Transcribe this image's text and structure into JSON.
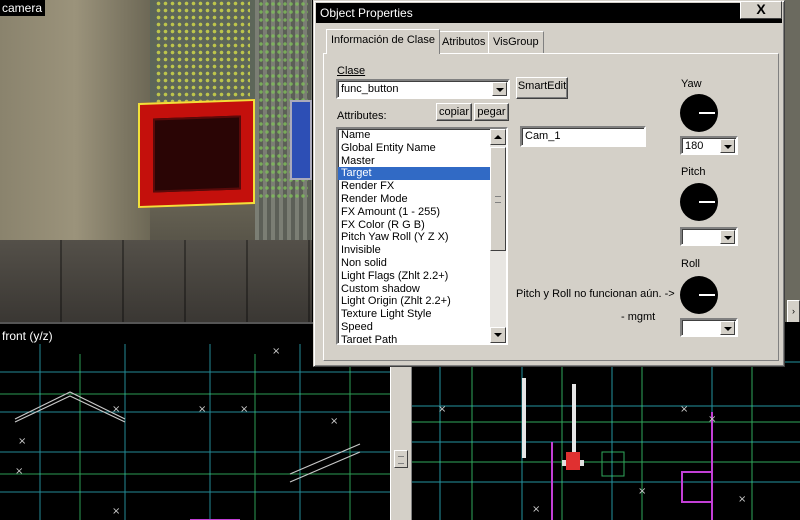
{
  "camera": {
    "label": "camera"
  },
  "front_view": {
    "label": "front (y/z)"
  },
  "dialog": {
    "title": "Object Properties",
    "close_label": "X",
    "tabs": [
      {
        "label": "Información de Clase",
        "active": true
      },
      {
        "label": "Atributos",
        "active": false
      },
      {
        "label": "VisGroup",
        "active": false
      }
    ],
    "class_label": "Clase",
    "class_value": "func_button",
    "smartedit_label": "SmartEdit",
    "attributes_label": "Attributes:",
    "copy_label": "copiar",
    "paste_label": "pegar",
    "attributes": [
      "Name",
      "Global Entity Name",
      "Master",
      "Target",
      "Render FX",
      "Render Mode",
      "FX Amount (1 - 255)",
      "FX Color (R G B)",
      "Pitch Yaw Roll (Y Z X)",
      "Invisible",
      "Non solid",
      "Light Flags (Zhlt 2.2+)",
      "Custom shadow",
      "Light Origin (Zhlt 2.2+)",
      "Texture Light Style",
      "Speed",
      "Target Path"
    ],
    "selected_attribute": "Target",
    "value_field": "Cam_1",
    "note_text": "Pitch y Roll no funcionan aún. ->",
    "note_author": "- mgmt",
    "yaw_label": "Yaw",
    "yaw_value": "180",
    "pitch_label": "Pitch",
    "pitch_value": "",
    "roll_label": "Roll",
    "roll_value": ""
  },
  "colors": {
    "selection": "#316ac5",
    "button_red": "#c4100c",
    "button_border": "#f2df3a",
    "grid_cyan": "#2fb8c8",
    "grid_green": "#3fe07a",
    "grid_magenta": "#c33fd6",
    "grid_white": "#d8d8d8"
  }
}
